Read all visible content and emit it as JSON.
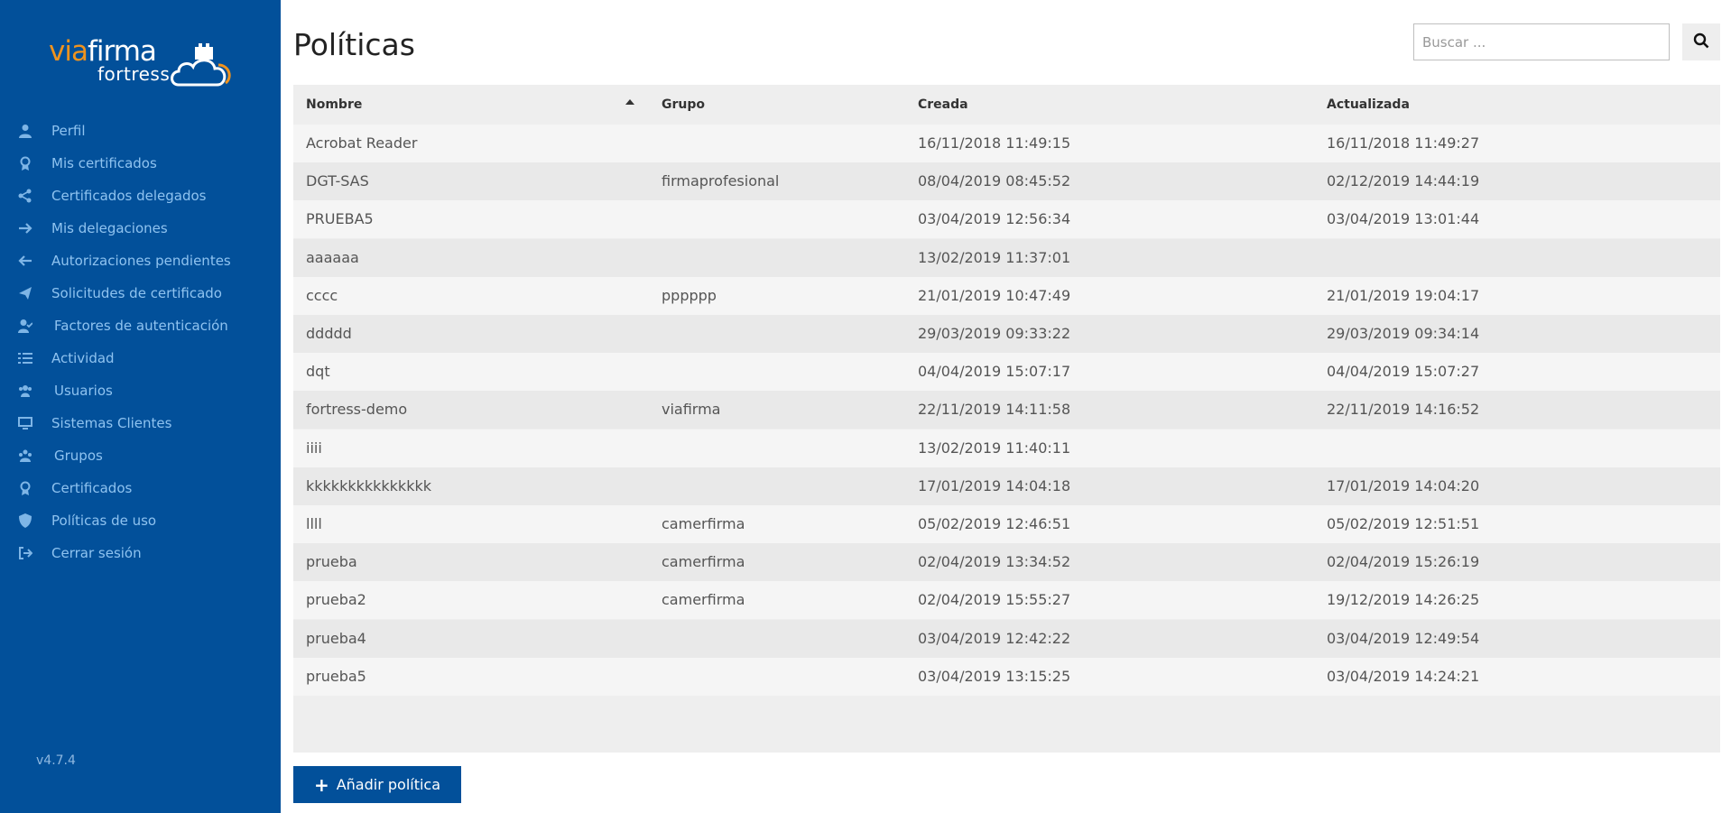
{
  "brand": {
    "via": "via",
    "firma": "firma",
    "sub": "fortress"
  },
  "sidebar": {
    "items": [
      {
        "label": "Perfil",
        "icon": "user-icon"
      },
      {
        "label": "Mis certificados",
        "icon": "certificate-icon"
      },
      {
        "label": "Certificados delegados",
        "icon": "share-icon"
      },
      {
        "label": "Mis delegaciones",
        "icon": "arrow-right-icon"
      },
      {
        "label": "Autorizaciones pendientes",
        "icon": "arrow-left-icon"
      },
      {
        "label": "Solicitudes de certificado",
        "icon": "paper-plane-icon"
      },
      {
        "label": "Factores de autenticación",
        "icon": "user-check-icon"
      },
      {
        "label": "Actividad",
        "icon": "list-icon"
      },
      {
        "label": "Usuarios",
        "icon": "users-icon"
      },
      {
        "label": "Sistemas Clientes",
        "icon": "desktop-icon"
      },
      {
        "label": "Grupos",
        "icon": "group-icon"
      },
      {
        "label": "Certificados",
        "icon": "certificate-icon"
      },
      {
        "label": "Políticas de uso",
        "icon": "shield-icon"
      },
      {
        "label": "Cerrar sesión",
        "icon": "sign-out-icon"
      }
    ],
    "version": "v4.7.4"
  },
  "page": {
    "title": "Políticas"
  },
  "search": {
    "placeholder": "Buscar ..."
  },
  "table": {
    "headers": {
      "name": "Nombre",
      "group": "Grupo",
      "created": "Creada",
      "updated": "Actualizada"
    },
    "rows": [
      {
        "name": "Acrobat Reader",
        "group": "",
        "created": "16/11/2018 11:49:15",
        "updated": "16/11/2018 11:49:27"
      },
      {
        "name": "DGT-SAS",
        "group": "firmaprofesional",
        "created": "08/04/2019 08:45:52",
        "updated": "02/12/2019 14:44:19"
      },
      {
        "name": "PRUEBA5",
        "group": "",
        "created": "03/04/2019 12:56:34",
        "updated": "03/04/2019 13:01:44"
      },
      {
        "name": "aaaaaa",
        "group": "",
        "created": "13/02/2019 11:37:01",
        "updated": ""
      },
      {
        "name": "cccc",
        "group": "pppppp",
        "created": "21/01/2019 10:47:49",
        "updated": "21/01/2019 19:04:17"
      },
      {
        "name": "ddddd",
        "group": "",
        "created": "29/03/2019 09:33:22",
        "updated": "29/03/2019 09:34:14"
      },
      {
        "name": "dqt",
        "group": "",
        "created": "04/04/2019 15:07:17",
        "updated": "04/04/2019 15:07:27"
      },
      {
        "name": "fortress-demo",
        "group": "viafirma",
        "created": "22/11/2019 14:11:58",
        "updated": "22/11/2019 14:16:52"
      },
      {
        "name": "iiii",
        "group": "",
        "created": "13/02/2019 11:40:11",
        "updated": ""
      },
      {
        "name": "kkkkkkkkkkkkkkk",
        "group": "",
        "created": "17/01/2019 14:04:18",
        "updated": "17/01/2019 14:04:20"
      },
      {
        "name": "llll",
        "group": "camerfirma",
        "created": "05/02/2019 12:46:51",
        "updated": "05/02/2019 12:51:51"
      },
      {
        "name": "prueba",
        "group": "camerfirma",
        "created": "02/04/2019 13:34:52",
        "updated": "02/04/2019 15:26:19"
      },
      {
        "name": "prueba2",
        "group": "camerfirma",
        "created": "02/04/2019 15:55:27",
        "updated": "19/12/2019 14:26:25"
      },
      {
        "name": "prueba4",
        "group": "",
        "created": "03/04/2019 12:42:22",
        "updated": "03/04/2019 12:49:54"
      },
      {
        "name": "prueba5",
        "group": "",
        "created": "03/04/2019 13:15:25",
        "updated": "03/04/2019 14:24:21"
      }
    ]
  },
  "actions": {
    "add_label": "Añadir política"
  },
  "colors": {
    "sidebar": "#02509a",
    "accent": "#f0931e",
    "nav_text": "#8fc3f0",
    "row_odd": "#f5f5f5",
    "row_even": "#e9e9e9"
  }
}
